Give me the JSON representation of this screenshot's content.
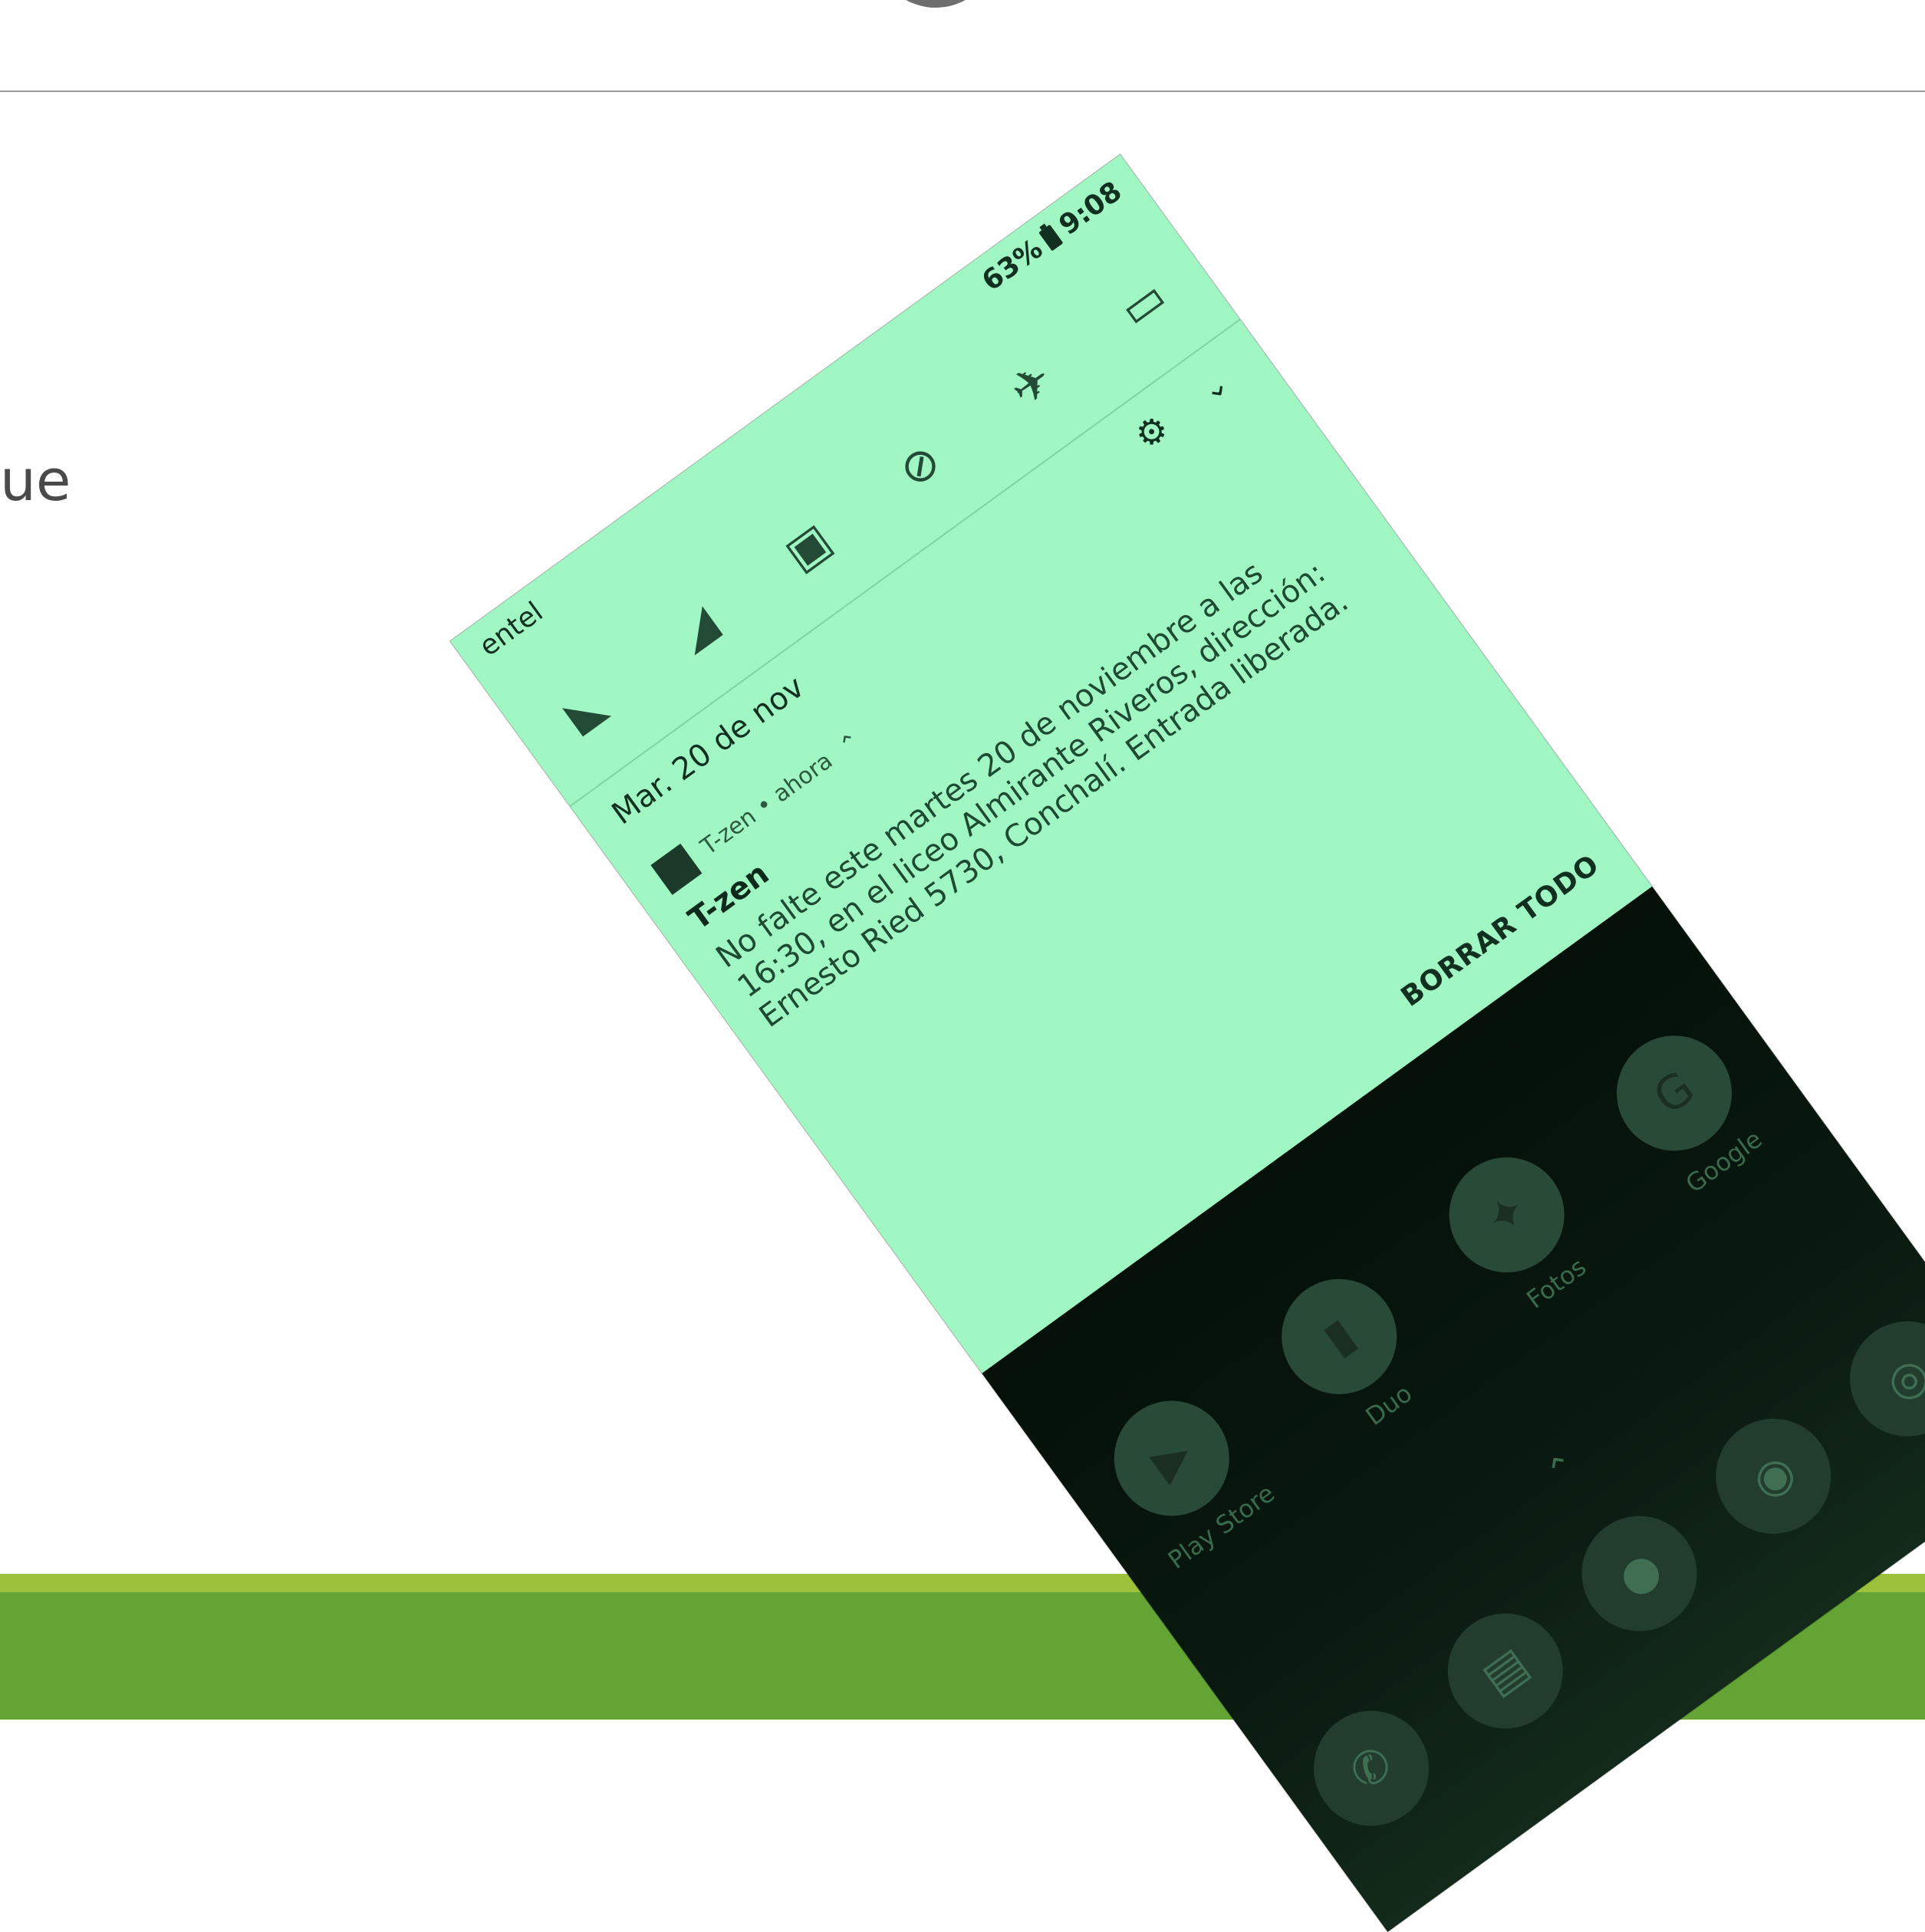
{
  "slide": {
    "side_text": "ue"
  },
  "phone": {
    "status": {
      "carrier": "entel",
      "battery": "63%",
      "time": "9:08"
    },
    "quick_settings": [
      {
        "name": "wifi"
      },
      {
        "name": "signal"
      },
      {
        "name": "battery-saver"
      },
      {
        "name": "do-not-disturb"
      },
      {
        "name": "airplane-mode"
      },
      {
        "name": "auto-rotate"
      }
    ],
    "date": "Mar. 20 de nov",
    "notification": {
      "app": "T-zen • ahora",
      "title": "T-zen",
      "body": "No falte este martes 20 de noviembre a las 16:30, en el liceo Almirante Riveros, dirección: Ernesto Ried 5730, Conchalí. Entrada liberada."
    },
    "clear_all": "BORRAR TODO",
    "apps": [
      {
        "label": "Play Store"
      },
      {
        "label": "Duo"
      },
      {
        "label": "Fotos"
      },
      {
        "label": "Google"
      }
    ]
  }
}
